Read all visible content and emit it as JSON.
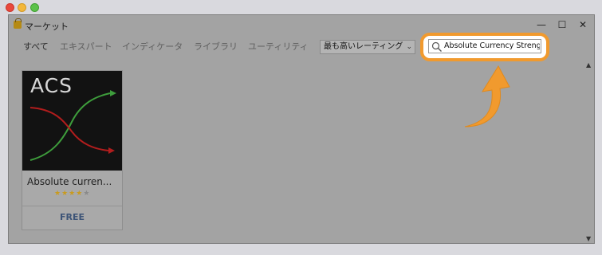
{
  "window": {
    "title": "マーケット",
    "controls": {
      "minimize": "—",
      "maximize": "☐",
      "close": "✕"
    }
  },
  "tabs": [
    {
      "label": "すべて",
      "active": true
    },
    {
      "label": "エキスパート",
      "active": false
    },
    {
      "label": "インディケータ",
      "active": false
    },
    {
      "label": "ライブラリ",
      "active": false
    },
    {
      "label": "ユーティリティ",
      "active": false
    }
  ],
  "sort": {
    "selected": "最も高いレーティング",
    "chevron": "⌄"
  },
  "search": {
    "value": "Absolute Currency Strengt",
    "icon": "search-icon"
  },
  "scroll": {
    "up": "▲",
    "down": "▼"
  },
  "products": [
    {
      "thumb_text": "ACS",
      "title": "Absolute curren...",
      "rating": 4,
      "max_rating": 5,
      "price": "FREE"
    }
  ],
  "colors": {
    "highlight": "#f19a2e",
    "arrow": "#f19a2e",
    "price_text": "#3d5477",
    "star": "#c99b1e",
    "green_line": "#3e9d3c",
    "red_line": "#b11d1d"
  }
}
